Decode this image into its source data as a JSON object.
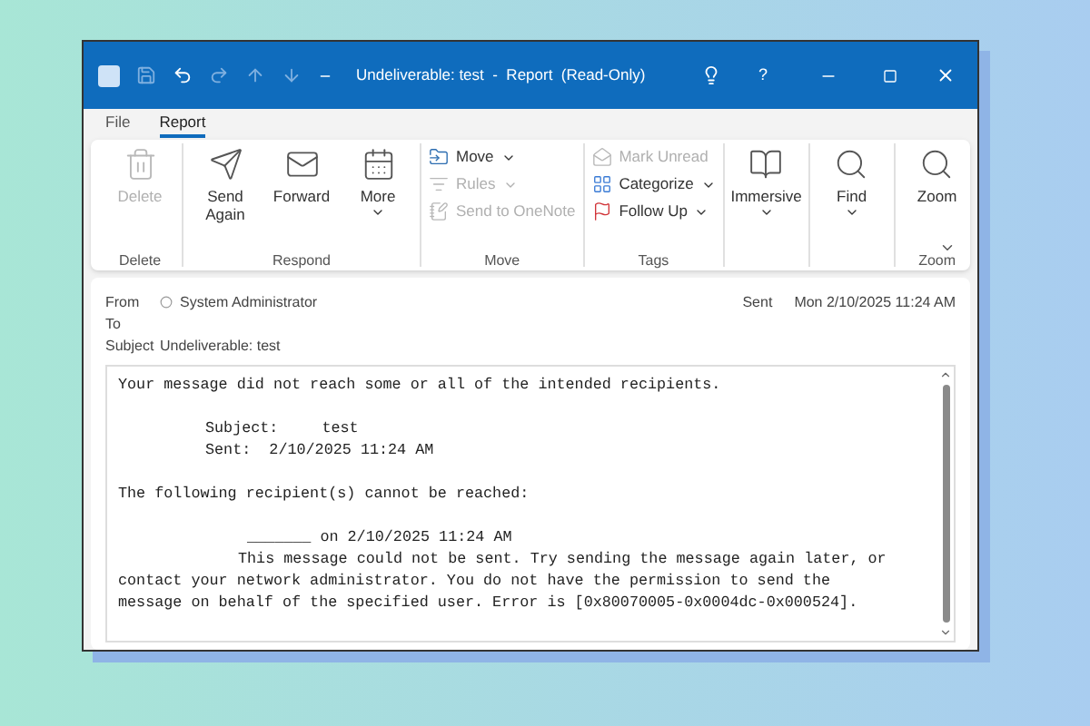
{
  "window": {
    "title": "Undeliverable: test  -  Report  (Read-Only)",
    "help": "?"
  },
  "tabs": [
    {
      "label": "File",
      "selected": false
    },
    {
      "label": "Report",
      "selected": true
    }
  ],
  "ribbon": [
    {
      "label": "Delete",
      "items": [
        {
          "label": "Delete",
          "kind": "large",
          "disabled": true,
          "has_menu": false
        }
      ]
    },
    {
      "label": "Respond",
      "items": [
        {
          "label": "Send Again",
          "kind": "large",
          "disabled": false,
          "has_menu": false
        },
        {
          "label": "Forward",
          "kind": "large",
          "disabled": false,
          "has_menu": false
        },
        {
          "label": "More",
          "kind": "large",
          "disabled": false,
          "has_menu": true
        }
      ]
    },
    {
      "label": "Move",
      "items": [
        {
          "label": "Move",
          "kind": "small",
          "disabled": false,
          "has_menu": true
        },
        {
          "label": "Rules",
          "kind": "small",
          "disabled": true,
          "has_menu": true
        },
        {
          "label": "Send to OneNote",
          "kind": "small",
          "disabled": true,
          "has_menu": false
        }
      ]
    },
    {
      "label": "Tags",
      "items": [
        {
          "label": "Mark Unread",
          "kind": "small",
          "disabled": true,
          "has_menu": false
        },
        {
          "label": "Categorize",
          "kind": "small",
          "disabled": false,
          "has_menu": true
        },
        {
          "label": "Follow Up",
          "kind": "small",
          "disabled": false,
          "has_menu": true
        }
      ]
    },
    {
      "items": [
        {
          "label": "Immersive",
          "kind": "large",
          "disabled": false,
          "has_menu": true
        }
      ]
    },
    {
      "items": [
        {
          "label": "Find",
          "kind": "large",
          "disabled": false,
          "has_menu": true
        }
      ]
    },
    {
      "label": "Zoom",
      "items": [
        {
          "label": "Zoom",
          "kind": "large",
          "disabled": false,
          "has_menu": false
        }
      ]
    }
  ],
  "header": {
    "from_label": "From",
    "sender": "System Administrator",
    "to_label": "To",
    "subject_label": "Subject",
    "subject": "Undeliverable: test",
    "sent_label": "Sent",
    "sent_value": "Mon 2/10/2025 11:24 AM"
  },
  "body": {
    "intro": "Your message did not reach some or all of the intended recipients.",
    "subject_label": "Subject:",
    "subject_value": "test",
    "sent_line": "Sent:  2/10/2025 11:24 AM",
    "recipients_heading": "The following recipient(s) cannot be reached:",
    "recipient_line": "_______ on 2/10/2025 11:24 AM",
    "error": "This message could not be sent. Try sending the message again later, or contact your network administrator. You do not have the permission to send the message on behalf of the specified user. Error is [0x80070005-0x0004dc-0x000524]."
  }
}
